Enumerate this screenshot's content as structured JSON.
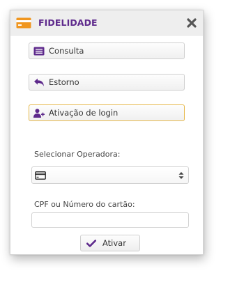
{
  "dialog": {
    "title": "FIDELIDADE",
    "title_color": "#5e2a8c",
    "title_icon": "credit-card-icon",
    "title_icon_color": "#f0961f",
    "close_icon": "close-icon"
  },
  "actions": {
    "consulta_label": "Consulta",
    "consulta_icon": "list-icon",
    "estorno_label": "Estorno",
    "estorno_icon": "undo-arrow-icon",
    "ativacao_label": "Ativação de login",
    "ativacao_icon": "add-user-icon",
    "icon_color": "#5e2a8c",
    "active_border_color": "#e6b84a"
  },
  "form": {
    "operadora_label": "Selecionar Operadora:",
    "operadora_value": "",
    "operadora_icon": "credit-card-icon",
    "card_label": "CPF ou Número do cartão:",
    "card_value": "",
    "card_placeholder": "",
    "submit_label": "Ativar",
    "submit_icon": "check-icon"
  }
}
